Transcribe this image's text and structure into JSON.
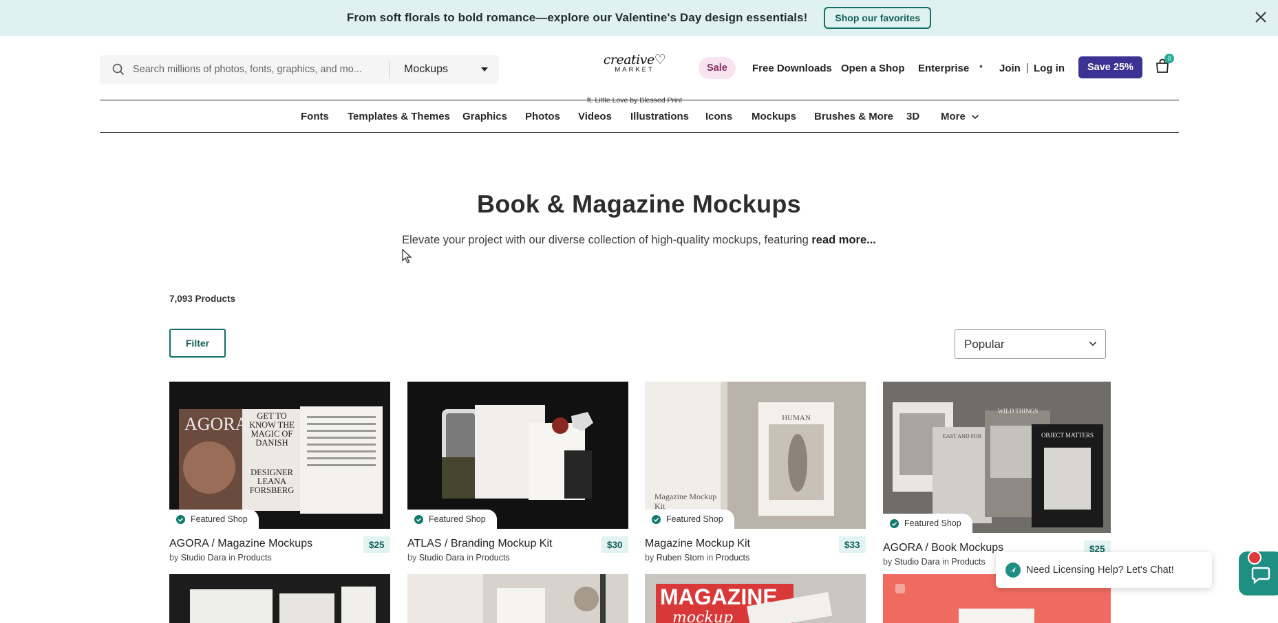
{
  "banner": {
    "text": "From soft florals to bold romance—explore our Valentine's Day design essentials!",
    "button": "Shop our favorites"
  },
  "header": {
    "search_placeholder": "Search millions of photos, fonts, graphics, and mo...",
    "category": "Mockups",
    "logo_script": "creative♡",
    "logo_market": "MARKET",
    "logo_tag": "ft. Little Love by Blessed Print",
    "sale": "Sale",
    "links": [
      "Free Downloads",
      "Open a Shop",
      "Enterprise"
    ],
    "dot": "•",
    "join": "Join",
    "sep": "|",
    "login": "Log in",
    "save": "Save 25%",
    "cart_count": "0"
  },
  "categories": [
    "Fonts",
    "Templates & Themes",
    "Graphics",
    "Photos",
    "Videos",
    "Illustrations",
    "Icons",
    "Mockups",
    "Brushes & More",
    "3D",
    "More"
  ],
  "main": {
    "title": "Book & Magazine Mockups",
    "description": "Elevate your project with our diverse collection of high-quality mockups, featuring",
    "read_more": "read more...",
    "count": "7,093 Products",
    "filter": "Filter",
    "sort": "Popular"
  },
  "products": [
    {
      "badge": "Featured Shop",
      "title": "AGORA / Magazine Mockups",
      "price": "$25",
      "by": "by",
      "author": "Studio Dara",
      "in": "in",
      "category": "Products"
    },
    {
      "badge": "Featured Shop",
      "title": "ATLAS / Branding Mockup Kit",
      "price": "$30",
      "by": "by",
      "author": "Studio Dara",
      "in": "in",
      "category": "Products"
    },
    {
      "badge": "Featured Shop",
      "title": "Magazine Mockup Kit",
      "price": "$33",
      "by": "by",
      "author": "Ruben Stom",
      "in": "in",
      "category": "Products"
    },
    {
      "badge": "Featured Shop",
      "title": "AGORA / Book Mockups",
      "price": "$25",
      "by": "by",
      "author": "Studio Dara",
      "in": "in",
      "category": "Products"
    }
  ],
  "image_text": {
    "agora": "AGORA",
    "magic": "GET TO KNOW THE MAGIC OF DANISH",
    "designer": "DESIGNER LEANA FORSBERG",
    "human": "HUMAN",
    "mag_kit": "Magazine Mockup Kit",
    "wild": "WILD THINGS",
    "east": "EAST AND FOR",
    "object": "OBJECT MATTERS",
    "magazine": "MAGAZINE",
    "mockup": "mockup"
  },
  "chat": {
    "text": "Need Licensing Help? Let's Chat!"
  },
  "colors": {
    "banner_bg": "#dff2f1",
    "accent_teal": "#0f6e66",
    "save_purple": "#3b3294",
    "sale_pink": "#f8e4ef"
  }
}
